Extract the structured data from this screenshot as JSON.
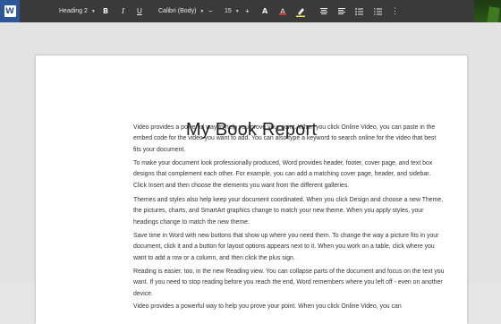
{
  "toolbar": {
    "app_icon": "word-icon",
    "style": "Heading 2",
    "bold": "B",
    "italic": "I",
    "underline": "U",
    "font": "Calibri (Body)",
    "decrease_size": "−",
    "font_size": "15",
    "increase_size": "+",
    "font_color_letter": "A",
    "highlight_icon": "highlighter-icon",
    "font_color": "#d13438",
    "highlight_color": "#f7e84a"
  },
  "document": {
    "title": "My Book Report",
    "paragraphs": [
      "Video provides a powerful way to help you prove your point. When you click Online Video, you can paste in the embed code for the video you want to add. You can also type a keyword to search online for the video that best fits your document.",
      "To make your document look professionally produced, Word provides header, footer, cover page, and text box designs that complement each other. For example, you can add a matching cover page, header, and sidebar. Click Insert and then choose the elements you want from the different galleries.",
      "Themes and styles also help keep your document coordinated. When you click Design and choose a new Theme, the pictures, charts, and SmartArt graphics change to match your new theme. When you apply styles, your headings change to match the new theme.",
      "Save time in Word with new buttons that show up where you need them. To change the way a picture fits in your document, click it and a button for layout options appears next to it. When you work on a table, click where you want to add a row or a column, and then click the plus sign.",
      "Reading is easier, too, in the new Reading view. You can collapse parts of the document and focus on the text you want. If you need to stop reading before you reach the end, Word remembers where you left off - even on another device.",
      "Video provides a powerful way to help you prove your point. When you click Online Video, you can"
    ]
  }
}
